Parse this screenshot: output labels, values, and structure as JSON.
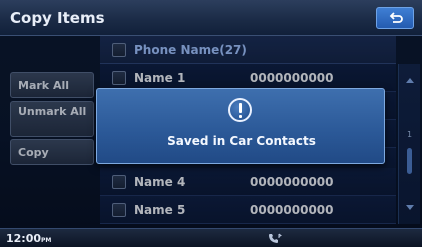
{
  "header": {
    "title": "Copy Items",
    "back_icon": "return-arrow-icon"
  },
  "side_buttons": [
    {
      "label": "Mark All"
    },
    {
      "label": "Unmark All"
    },
    {
      "label": "Copy"
    }
  ],
  "list": {
    "header_label": "Phone Name(27)",
    "rows": [
      {
        "name": "Name 1",
        "number": "0000000000"
      },
      {
        "name": "Name 4",
        "number": "0000000000"
      },
      {
        "name": "Name 5",
        "number": "0000000000"
      }
    ],
    "scroll_page": "1"
  },
  "popup": {
    "icon": "info-icon",
    "message": "Saved in Car Contacts"
  },
  "status": {
    "time": "12:00",
    "time_suffix": "PM",
    "phone_icon": "bluetooth-phone-icon"
  },
  "colors": {
    "popup": "#2c5a99",
    "accent": "#3f7fd4",
    "background": "#0c1a33"
  }
}
